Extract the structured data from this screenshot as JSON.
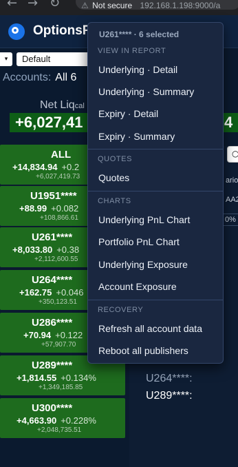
{
  "browser": {
    "back_icon": "back-arrow-icon",
    "forward_icon": "forward-arrow-icon",
    "reload_icon": "reload-icon",
    "security_label": "Not secure",
    "url": "192.168.1.198:9000/a"
  },
  "header": {
    "app_title": "OptionsR"
  },
  "toolbar": {
    "selected_view": "Default"
  },
  "accounts": {
    "label": "Accounts:",
    "value": "All 6"
  },
  "netliq": {
    "label": "Net Liq",
    "label_suffix": "cal",
    "value": "+6,027,41",
    "right_value": "4"
  },
  "cards": [
    {
      "name": "ALL",
      "pnl": "+14,834.94",
      "pct": "+0.2",
      "netliq": "+6,027,419.73"
    },
    {
      "name": "U1951****",
      "pnl": "+88.99",
      "pct": "+0.082",
      "netliq": "+108,866.61"
    },
    {
      "name": "U261****",
      "pnl": "+8,033.80",
      "pct": "+0.38",
      "netliq": "+2,112,600.55"
    },
    {
      "name": "U264****",
      "pnl": "+162.75",
      "pct": "+0.046",
      "netliq": "+350,123.51"
    },
    {
      "name": "U286****",
      "pnl": "+70.94",
      "pct": "+0.122",
      "netliq": "+57,907.70"
    },
    {
      "name": "U289****",
      "pnl": "+1,814.55",
      "pct": "+0.134%",
      "netliq": "+1,349,185.85"
    },
    {
      "name": "U300****",
      "pnl": "+4,663.90",
      "pct": "+0.228%",
      "netliq": "+2,048,735.51"
    }
  ],
  "right_panel": {
    "tag1": "ario",
    "tag2": "0%",
    "tag3": "AA2",
    "accounts": [
      "U264****:",
      "U289****:"
    ]
  },
  "menu": {
    "header": "U261**** · 6 selected",
    "sections": [
      {
        "title": "VIEW IN REPORT",
        "items": [
          "Underlying · Detail",
          "Underlying · Summary",
          "Expiry · Detail",
          "Expiry · Summary"
        ]
      },
      {
        "title": "QUOTES",
        "items": [
          "Quotes"
        ]
      },
      {
        "title": "CHARTS",
        "items": [
          "Underlying PnL Chart",
          "Portfolio PnL Chart",
          "Underlying Exposure",
          "Account Exposure"
        ]
      },
      {
        "title": "RECOVERY",
        "items": [
          "Refresh all account data",
          "Reboot all publishers"
        ]
      }
    ]
  },
  "colors": {
    "card_green": "#1e6b1e",
    "menu_bg": "#1a2740",
    "app_bg": "#0b1a2f"
  }
}
